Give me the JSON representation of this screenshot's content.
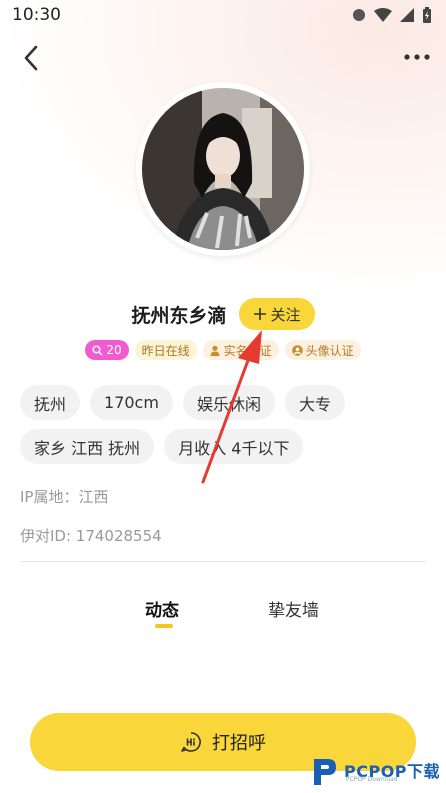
{
  "status_bar": {
    "time": "10:30"
  },
  "profile": {
    "name": "抚州东乡滴",
    "follow_label": "关注",
    "badges": [
      {
        "icon": "search-icon",
        "label": "20"
      },
      {
        "icon": "",
        "label": "昨日在线"
      },
      {
        "icon": "person-verified-icon",
        "label": "实名认证"
      },
      {
        "icon": "avatar-verified-icon",
        "label": "头像认证"
      }
    ],
    "tags": [
      "抚州",
      "170cm",
      "娱乐休闲",
      "大专",
      "家乡 江西 抚州",
      "月收入 4千以下"
    ],
    "ip_location": "IP属地：江西",
    "user_id": "伊对ID: 174028554"
  },
  "tabs": [
    {
      "label": "动态",
      "active": true
    },
    {
      "label": "挚友墙",
      "active": false
    }
  ],
  "greet_button": {
    "label": "打招呼"
  },
  "watermark": {
    "brand": "PCPOP下载",
    "sub": "PCPOP Download"
  },
  "colors": {
    "accent_yellow": "#f9d63a",
    "pink_badge": "#f25bd0",
    "annotation_arrow": "#e53b2f"
  }
}
